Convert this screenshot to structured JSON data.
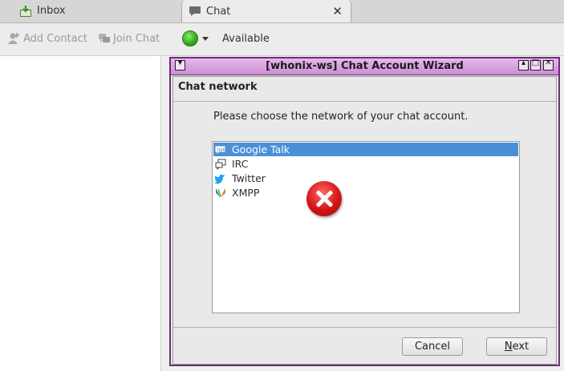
{
  "tabs": [
    {
      "label": "Inbox",
      "icon": "inbox-icon"
    },
    {
      "label": "Chat",
      "icon": "chat-bubble-icon",
      "close": "✕"
    }
  ],
  "toolbar": {
    "add_contact": "Add Contact",
    "join_chat": "Join Chat",
    "status": "Available"
  },
  "wizard": {
    "title": "[whonix-ws] Chat Account Wizard",
    "heading": "Chat network",
    "prompt": "Please choose the network of your chat account.",
    "networks": [
      {
        "label": "Google Talk",
        "icon": "google-talk-icon",
        "selected": true
      },
      {
        "label": "IRC",
        "icon": "irc-icon",
        "selected": false
      },
      {
        "label": "Twitter",
        "icon": "twitter-icon",
        "selected": false
      },
      {
        "label": "XMPP",
        "icon": "xmpp-icon",
        "selected": false
      }
    ],
    "cancel": "Cancel",
    "next_prefix": "N",
    "next_rest": "ext"
  },
  "colors": {
    "selection": "#4a90d9",
    "titlebar": "#c98fd2",
    "status_available": "#2fa81a",
    "error": "#d31414"
  }
}
